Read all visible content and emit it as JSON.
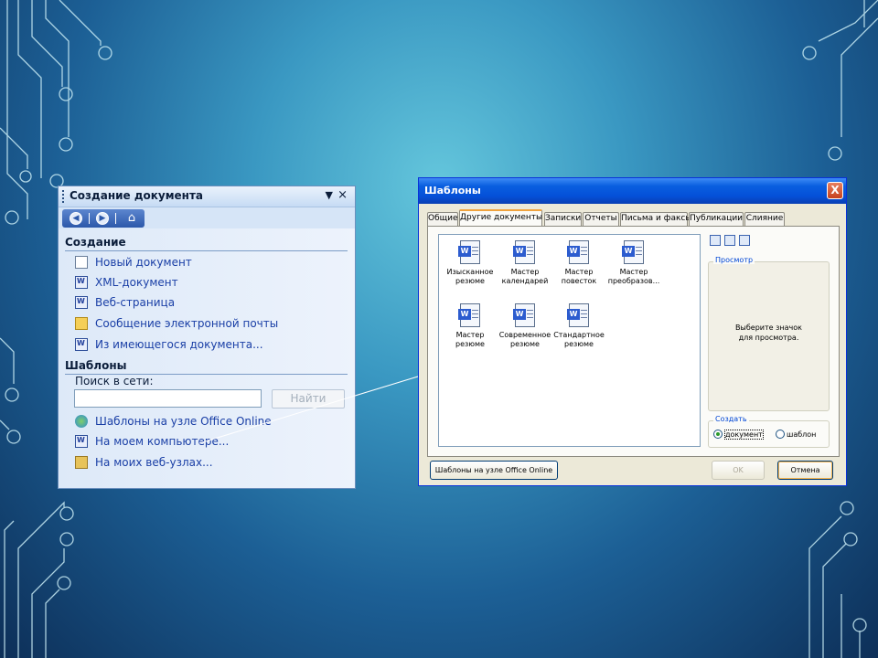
{
  "colors": {
    "title_bar": "#0a5fe0",
    "pane_bg": "#d6e5f7",
    "link": "#1a3fa6",
    "dialog_bg": "#ece9d8"
  },
  "task_pane": {
    "title": "Создание документа",
    "dropdown_icon": "down-arrow",
    "close_label": "×",
    "nav": {
      "back_icon": "back-arrow-icon",
      "forward_icon": "forward-arrow-icon",
      "home_icon": "home-icon"
    },
    "create_section": {
      "heading": "Создание",
      "items": [
        {
          "label": "Новый документ",
          "icon": "blank-document-icon"
        },
        {
          "label": "XML-документ",
          "icon": "word-document-icon"
        },
        {
          "label": "Веб-страница",
          "icon": "web-page-icon"
        },
        {
          "label": "Сообщение электронной почты",
          "icon": "email-icon"
        },
        {
          "label": "Из имеющегося документа...",
          "icon": "word-document-icon"
        }
      ]
    },
    "templates_section": {
      "heading": "Шаблоны",
      "search_label": "Поиск в сети:",
      "search_value": "",
      "find_button": "Найти",
      "items": [
        {
          "label": "Шаблоны на узле Office Online",
          "icon": "office-online-icon"
        },
        {
          "label": "На моем компьютере...",
          "icon": "word-document-icon"
        },
        {
          "label": "На моих веб-узлах...",
          "icon": "folder-icon"
        }
      ]
    }
  },
  "dialog": {
    "title": "Шаблоны",
    "close_label": "X",
    "tabs": [
      "Общие",
      "Другие документы",
      "Записки",
      "Отчеты",
      "Письма и факсы",
      "Публикации",
      "Слияние"
    ],
    "active_tab": "Другие документы",
    "templates": [
      {
        "line1": "Изысканное",
        "line2": "резюме"
      },
      {
        "line1": "Мастер",
        "line2": "календарей"
      },
      {
        "line1": "Мастер",
        "line2": "повесток"
      },
      {
        "line1": "Мастер",
        "line2": "преобразов..."
      },
      {
        "line1": "Мастер",
        "line2": "резюме"
      },
      {
        "line1": "Современное",
        "line2": "резюме"
      },
      {
        "line1": "Стандартное",
        "line2": "резюме"
      }
    ],
    "view_buttons": [
      "large-icons-view-icon",
      "list-view-icon",
      "details-view-icon"
    ],
    "preview_label": "Просмотр",
    "preview_message_line1": "Выберите значок",
    "preview_message_line2": "для просмотра.",
    "create_label": "Создать",
    "create_options": [
      {
        "label": "документ",
        "selected": true
      },
      {
        "label": "шаблон",
        "selected": false
      }
    ],
    "office_online_button": "Шаблоны на узле Office Online",
    "ok_button": "OK",
    "cancel_button": "Отмена"
  }
}
